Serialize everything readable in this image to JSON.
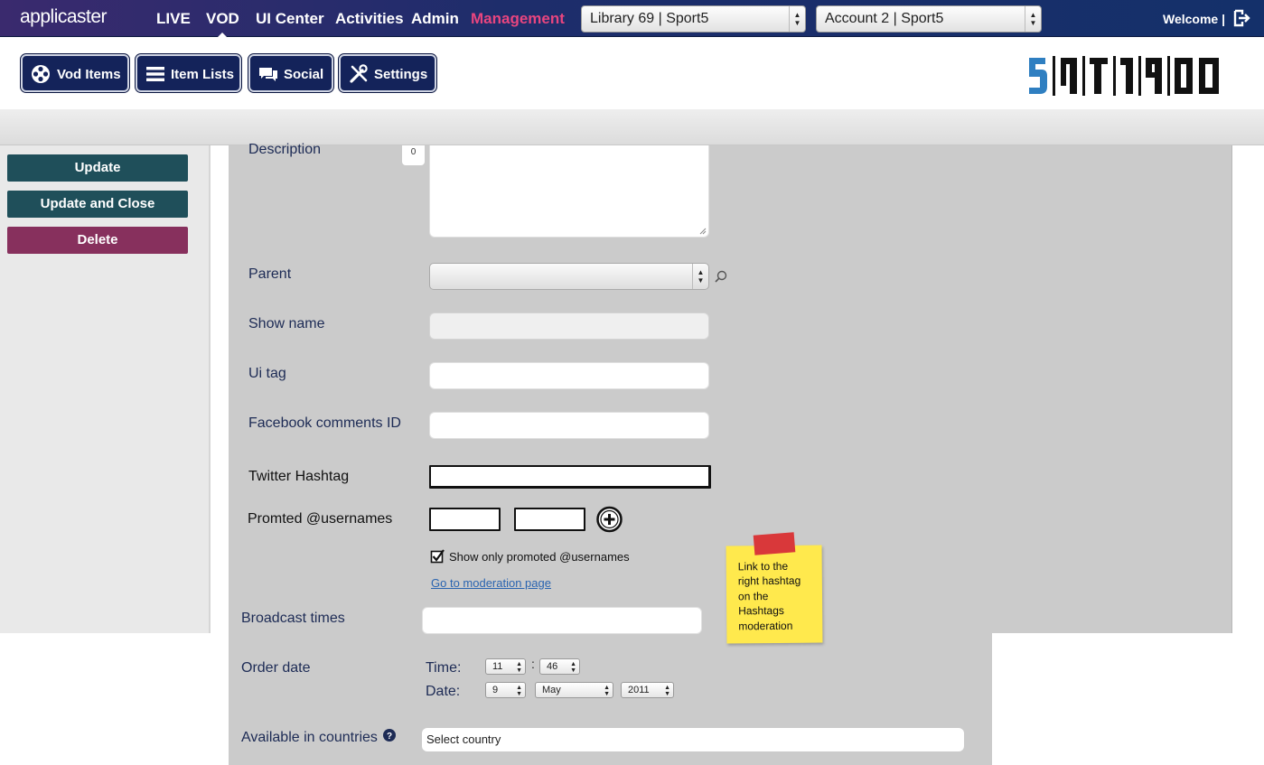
{
  "app": {
    "logo": "applicaster"
  },
  "topnav": {
    "items": [
      {
        "label": "LIVE"
      },
      {
        "label": "VOD"
      },
      {
        "label": "UI Center"
      },
      {
        "label": "Activities"
      },
      {
        "label": "Admin"
      },
      {
        "label": "Management"
      }
    ],
    "library_select": "Library 69 | Sport5",
    "account_select": "Account 2 | Sport5",
    "welcome": "Welcome |"
  },
  "mainnav": {
    "vod_items": "Vod Items",
    "item_lists": "Item Lists",
    "social": "Social",
    "settings": "Settings"
  },
  "sidebar": {
    "update": "Update",
    "update_close": "Update and Close",
    "delete": "Delete"
  },
  "form": {
    "description_label": "Description",
    "description_count": "0",
    "parent_label": "Parent",
    "show_name_label": "Show name",
    "ui_tag_label": "Ui tag",
    "facebook_label": "Facebook comments ID",
    "twitter_label": "Twitter Hashtag",
    "promoted_label": "Promted @usernames",
    "show_only_promoted": "Show only promoted @usernames",
    "show_only_promoted_checked": true,
    "moderation_link": "Go to moderation page",
    "broadcast_label": "Broadcast times",
    "order_date_label": "Order date",
    "time_label": "Time:",
    "date_label": "Date:",
    "time_separator": ":",
    "hour": "11",
    "minute": "46",
    "day": "9",
    "month": "May",
    "year": "2011",
    "countries_label": "Available in countries",
    "countries_placeholder": "Select country"
  },
  "sticky_note": {
    "lines": [
      "Link to the",
      "right hashtag",
      "on the",
      "Hashtags",
      "moderation"
    ]
  },
  "colors": {
    "accent_pink": "#e8457f",
    "nav_dark": "#14235a",
    "sidebar_teal": "#1f4f5a",
    "delete_plum": "#87305d",
    "sticky_yellow": "#ffe94d"
  }
}
